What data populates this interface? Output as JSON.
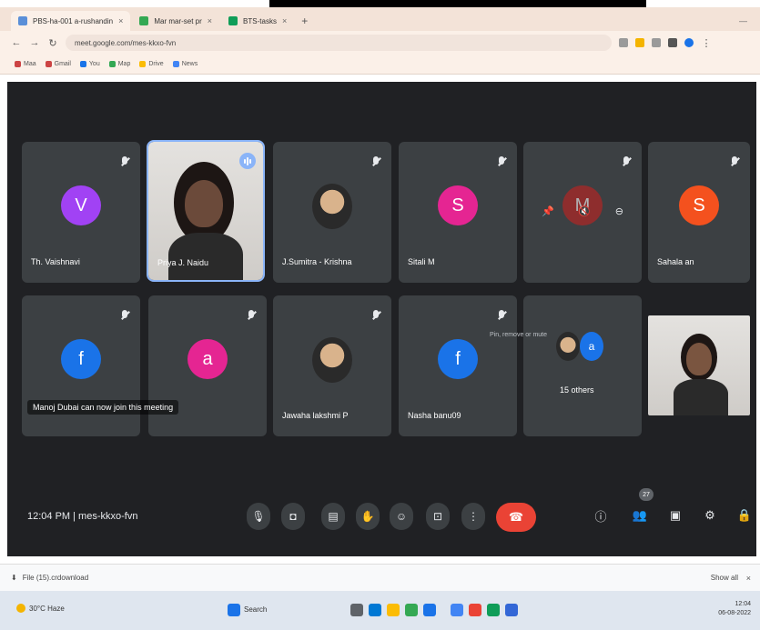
{
  "browser": {
    "tabs": [
      {
        "label": "PBS-ha-001 a-rushandin"
      },
      {
        "label": "Mar mar-set pr"
      },
      {
        "label": "BTS-tasks"
      }
    ],
    "url": "meet.google.com/mes-kkxo-fvn",
    "bookmarks": [
      "Maa",
      "Gmail",
      "You",
      "Map",
      "Drive",
      "News"
    ]
  },
  "meet": {
    "tiles": [
      {
        "name": "Th. Vaishnavi",
        "initial": "V",
        "color": "#a142f4",
        "type": "letter"
      },
      {
        "name": "Priya J. Naidu",
        "type": "video-speaking"
      },
      {
        "name": "J.Sumitra - Krishna",
        "type": "photo"
      },
      {
        "name": "Sitali M",
        "initial": "S",
        "color": "#e52592",
        "type": "letter"
      },
      {
        "name": "",
        "initial": "M",
        "color": "#c5221f",
        "type": "hover"
      },
      {
        "name": "Sahala an",
        "initial": "S",
        "color": "#f4511e",
        "type": "letter"
      },
      {
        "name": "",
        "initial": "f",
        "color": "#1a73e8",
        "type": "letter"
      },
      {
        "name": "",
        "initial": "a",
        "color": "#e52592",
        "type": "letter"
      },
      {
        "name": "Jawaha lakshmi P",
        "type": "photo"
      },
      {
        "name": "Nasha banu09",
        "initial": "f",
        "color": "#1a73e8",
        "type": "letter"
      },
      {
        "name": "15 others",
        "type": "others"
      },
      {
        "name": "",
        "type": "video-self"
      }
    ],
    "hover_tooltip": "Pin, remove or mute",
    "caption": "Manoj Dubai can now join this meeting",
    "time_and_code": "12:04 PM  |  mes-kkxo-fvn",
    "controls": [
      {
        "name": "mic-button",
        "icon": "🎙"
      },
      {
        "name": "camera-button",
        "icon": "◘"
      },
      {
        "name": "captions-button",
        "icon": "▤"
      },
      {
        "name": "raise-hand-button",
        "icon": "✋"
      },
      {
        "name": "emoji-button",
        "icon": "☺"
      },
      {
        "name": "present-button",
        "icon": "⊡"
      },
      {
        "name": "more-options-button",
        "icon": "⋮"
      }
    ],
    "hangup_icon": "☎",
    "right_icons": [
      {
        "name": "info-icon",
        "icon": "ⓘ"
      },
      {
        "name": "people-icon",
        "icon": "👥"
      },
      {
        "name": "chat-icon",
        "icon": "▣"
      },
      {
        "name": "activities-icon",
        "icon": "⚙"
      },
      {
        "name": "host-controls-icon",
        "icon": "🔒"
      }
    ],
    "people_count": "27"
  },
  "download_bar": {
    "file": "File (15).crdownload",
    "show_all": "Show all"
  },
  "taskbar": {
    "weather": "30°C Haze",
    "search": "Search",
    "time": "12:04",
    "date": "06-08-2022"
  },
  "colors": {
    "meet_bg": "#202124",
    "tile_bg": "#3c4043",
    "hangup": "#ea4335"
  }
}
